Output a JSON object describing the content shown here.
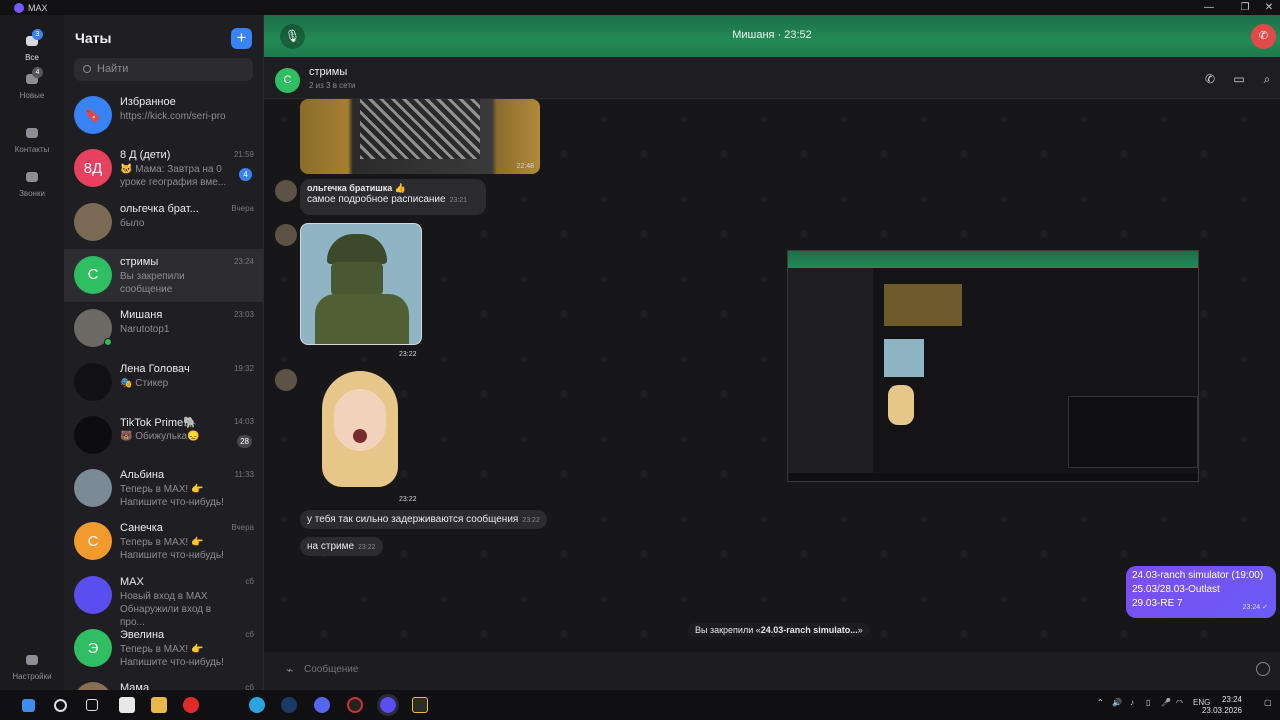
{
  "app": {
    "title": "MAX"
  },
  "rail": {
    "items": [
      {
        "label": "Все",
        "badge": "3"
      },
      {
        "label": "Новые",
        "badge": "4"
      },
      {
        "label": "Контакты"
      },
      {
        "label": "Звонки"
      },
      {
        "label": "Настройки"
      }
    ]
  },
  "chatlist": {
    "title": "Чаты",
    "search_placeholder": "Найти",
    "chats": [
      {
        "name": "Избранное",
        "sub": "https://kick.com/seri-pro",
        "time": "",
        "avatar_text": "",
        "color": "#3a82f7"
      },
      {
        "name": "8 Д (дети)",
        "sub": "🐱 Мама: Завтра на 0 уроке география вме...",
        "time": "21:59",
        "badge": "4",
        "avatar_text": "8Д",
        "color": "#e8405f"
      },
      {
        "name": "ольгечка брат...",
        "sub": "было",
        "time": "Вчера",
        "avatar_text": "",
        "color": "#7b6a55"
      },
      {
        "name": "стримы",
        "sub": "Вы закрепили сообщение",
        "time": "23:24",
        "avatar_text": "С",
        "color": "#2fbf62"
      },
      {
        "name": "Мишаня",
        "sub": "Narutotop1",
        "time": "23:03",
        "avatar_text": "",
        "color": "#6d6a64"
      },
      {
        "name": "Лена Головач",
        "sub": "🎭 Стикер",
        "time": "19:32",
        "avatar_text": "",
        "color": "#111113"
      },
      {
        "name": "TikTok Prime🐘",
        "sub": "🐻 Обижулька😞",
        "time": "14:03",
        "badge": "28",
        "avatar_text": "",
        "color": "#0d0d0f"
      },
      {
        "name": "Альбина",
        "sub": "Теперь в MAX! 👉 Напишите что-нибудь!",
        "time": "11:33",
        "avatar_text": "",
        "color": "#7c8a96"
      },
      {
        "name": "Санечка",
        "sub": "Теперь в MAX! 👉 Напишите что-нибудь!",
        "time": "Вчера",
        "avatar_text": "С",
        "color": "#f29a2e"
      },
      {
        "name": "MAX",
        "sub": "Новый вход в MAX Обнаружили вход в про...",
        "time": "сб",
        "avatar_text": "",
        "color": "#5b4ef0"
      },
      {
        "name": "Эвелина",
        "sub": "Теперь в MAX! 👉 Напишите что-нибудь!",
        "time": "сб",
        "avatar_text": "Э",
        "color": "#2fbf62"
      },
      {
        "name": "Мама",
        "sub": "",
        "time": "сб",
        "avatar_text": "",
        "color": "#8a6d55"
      }
    ]
  },
  "call": {
    "text": "Мишаня · 23:52"
  },
  "chat": {
    "name": "стримы",
    "avatar_text": "С",
    "subtitle": "2 из 3 в сети"
  },
  "messages": {
    "img1_time": "22:48",
    "m1_author": "ольгечка братишка 👍",
    "m1_text": "самое подробное расписание",
    "m1_time": "23:21",
    "sticker1_time": "23:22",
    "sticker2_time": "23:22",
    "m2_text": "у тебя так сильно задерживаются сообщения",
    "m2_time": "23:22",
    "m3_text": "на стриме",
    "m3_time": "23:22",
    "out_lines": [
      "24.03-ranch simulator (19:00)",
      "25.03/28.03-Outlast",
      "29.03-RE 7"
    ],
    "out_time": "23:24",
    "pinned_prefix": "Вы закрепили «",
    "pinned_bold": "24.03-ranch simulato...",
    "pinned_suffix": "»"
  },
  "composer": {
    "placeholder": "Сообщение"
  },
  "taskbar": {
    "lang": "ENG",
    "time": "23:24",
    "date": "23.03.2026"
  },
  "colors": {
    "accent": "#3a82f7",
    "call_green": "#238a56",
    "outgoing": "#7c4df2",
    "end_call": "#e24a4a"
  }
}
